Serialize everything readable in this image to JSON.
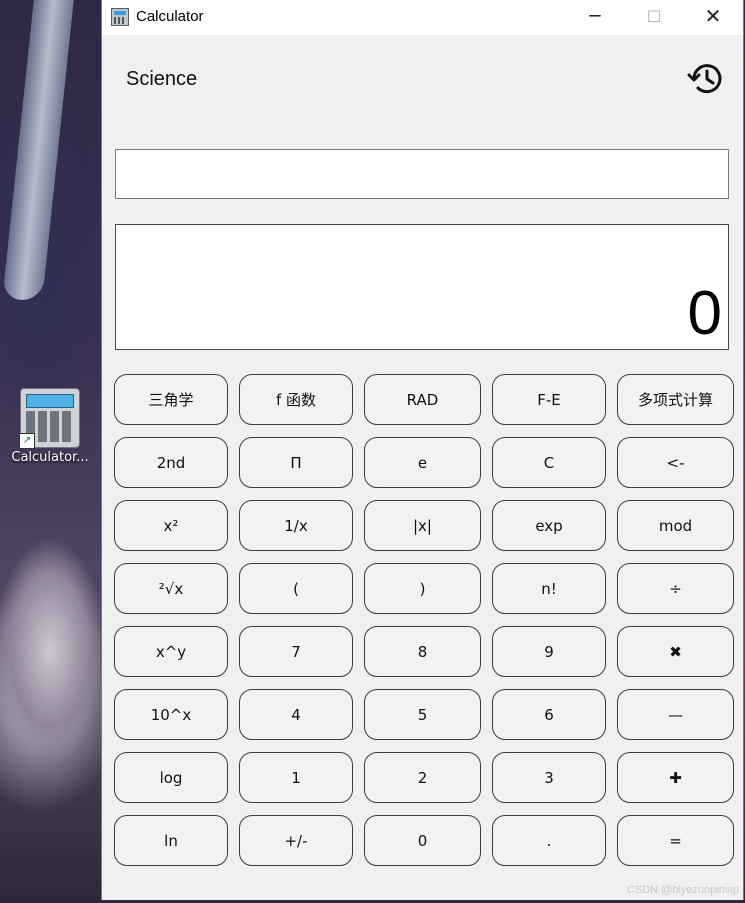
{
  "desktop": {
    "icon_label": "Calculator..."
  },
  "window": {
    "title": "Calculator",
    "minimize_glyph": "─",
    "maximize_glyph": "☐",
    "close_glyph": "✕"
  },
  "header": {
    "mode_title": "Science",
    "history_icon": "history-icon"
  },
  "display": {
    "expression": "",
    "result": "0"
  },
  "keypad": {
    "keys": [
      "三角学",
      "f 函数",
      "RAD",
      "F-E",
      "多项式计算",
      "2nd",
      "Π",
      "e",
      "C",
      "<-",
      "x²",
      "1/x",
      "|x|",
      "exp",
      "mod",
      "²√x",
      "(",
      ")",
      "n!",
      "÷",
      "x^y",
      "7",
      "8",
      "9",
      "✖",
      "10^x",
      "4",
      "5",
      "6",
      "—",
      "log",
      "1",
      "2",
      "3",
      "✚",
      "ln",
      "+/-",
      "0",
      ".",
      "="
    ]
  },
  "watermark": "CSDN @biyezuopinvip"
}
